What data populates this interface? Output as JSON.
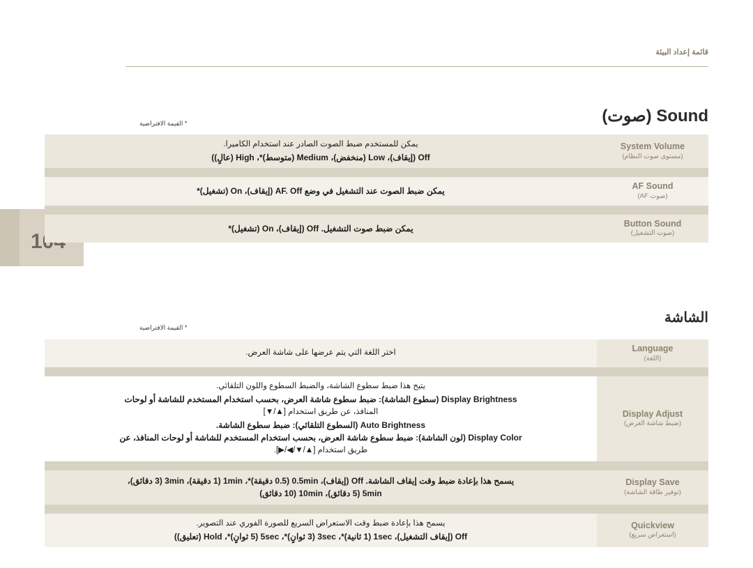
{
  "header": {
    "running_title": "قائمة إعداد البيئة",
    "page_number": "104"
  },
  "sections": [
    {
      "id": "sound",
      "title": "Sound (صوت)",
      "footnote": "* القيمة الافتراضية",
      "rows": [
        {
          "label_en": "System Volume",
          "label_ar": "(مستوى صوت النظام)",
          "lines": [
            {
              "text": "يمكن للمستخدم ضبط الصوت الصادر عند استخدام الكاميرا.",
              "bold": false
            },
            {
              "text": "Off (إيقاف)، Low (منخفض)، Medium (متوسط)*، High (عالٍ))",
              "bold": true
            }
          ],
          "shade": "a"
        },
        {
          "label_en": "AF Sound",
          "label_ar": "(صوت AF)",
          "lines": [
            {
              "text": "يمكن ضبط الصوت عند التشغيل في وضع AF. Off (إيقاف)، On (تشغيل)*",
              "bold": true
            }
          ],
          "shade": "b"
        },
        {
          "label_en": "Button Sound",
          "label_ar": "(صوت التشغيل)",
          "lines": [
            {
              "text": "يمكن ضبط صوت التشغيل. Off (إيقاف)، On (تشغيل)*",
              "bold": true
            }
          ],
          "shade": "a"
        }
      ]
    },
    {
      "id": "display",
      "title": "الشاشة",
      "footnote": "* القيمة الافتراضية",
      "rows": [
        {
          "label_en": "Language",
          "label_ar": "(اللغة)",
          "lines": [
            {
              "text": "اختر اللغة التي يتم عرضها على شاشة العرض.",
              "bold": false
            }
          ],
          "shade": "b"
        },
        {
          "label_en": "Display Adjust",
          "label_ar": "(ضبط شاشة العرض)",
          "lines": [
            {
              "text": "يتيح هذا ضبط سطوع الشاشة، والضبط السطوع واللون التلقائي.",
              "bold": false
            },
            {
              "text": "Display Brightness (سطوع الشاشة): ضبط سطوع شاشة العرض، بحسب استخدام المستخدم للشاشة أو لوحات",
              "bold": true
            },
            {
              "text": "المنافذ، عن طريق استخدام [▲/▼]",
              "bold": false
            },
            {
              "text": "Auto Brightness (السطوع التلقائي): ضبط سطوع الشاشة.",
              "bold": true
            },
            {
              "text": "Display Color (لون الشاشة): ضبط سطوع شاشة العرض، بحسب استخدام المستخدم للشاشة أو لوحات المنافذ، عن",
              "bold": true
            },
            {
              "text": "طريق استخدام [▲/▼/◀/▶].",
              "bold": false
            }
          ],
          "shade": "w"
        },
        {
          "label_en": "Display Save",
          "label_ar": "(توفير طاقة الشاشة)",
          "lines": [
            {
              "text": "يسمح هذا بإعادة ضبط وقت إيقاف الشاشة. Off (إيقاف)، 0.5min (0.5 دقيقة)*، 1min (1 دقيقة)، 3min (3 دقائق)،",
              "bold": true
            },
            {
              "text": "5min (5 دقائق)، 10min (10 دقائق)",
              "bold": true
            }
          ],
          "shade": "a"
        },
        {
          "label_en": "Quickview",
          "label_ar": "(استعراض سريع)",
          "lines": [
            {
              "text": "يسمح هذا بإعادة ضبط وقت الاستعراض السريع للصورة الفوري عند التصوير.",
              "bold": false
            },
            {
              "text": "Off (إيقاف التشغيل)، 1sec (1 ثانية)*، 3sec (3 ثوانٍ)*، 5sec (5 ثوانٍ)*، Hold (تعليق))",
              "bold": true
            }
          ],
          "shade": "b"
        }
      ]
    }
  ],
  "colors": {
    "label_text": "#8d8470",
    "row_shade_dark": "#ece7dc",
    "row_shade_light": "#f4f1ea",
    "header_text": "#8a7f68",
    "tab_band": "#d9d2c4"
  }
}
